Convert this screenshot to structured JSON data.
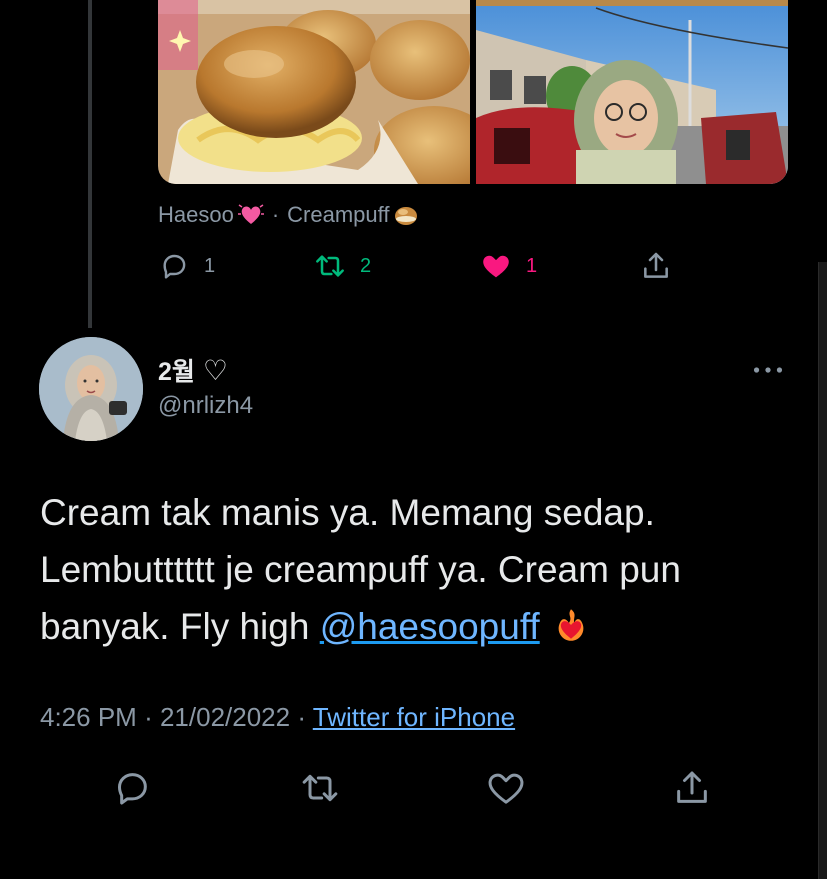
{
  "quoted_tweet": {
    "author_name": "Haesoo",
    "separator": "·",
    "author_secondary": "Creampuff",
    "reply_count": "1",
    "retweet_count": "2",
    "like_count": "1"
  },
  "tweet": {
    "display_name": "2월",
    "name_symbol": "♡",
    "handle": "@nrlizh4",
    "text_before_mention": "Cream tak manis ya. Memang sedap. Lembutttttt je creampuff ya. Cream pun banyak. Fly high ",
    "mention": "@haesoopuff",
    "time": "4:26 PM",
    "dot": "·",
    "date": "21/02/2022",
    "source": "Twitter for iPhone"
  },
  "colors": {
    "background": "#000000",
    "text_primary": "#e7e9ea",
    "text_secondary": "#8b98a5",
    "link": "#1d9bf0",
    "retweet_green": "#00ba7c",
    "like_pink": "#f91880"
  },
  "icons": {
    "reply": "reply-icon",
    "retweet": "retweet-icon",
    "like": "heart-icon",
    "share": "share-icon",
    "more": "more-icon"
  }
}
